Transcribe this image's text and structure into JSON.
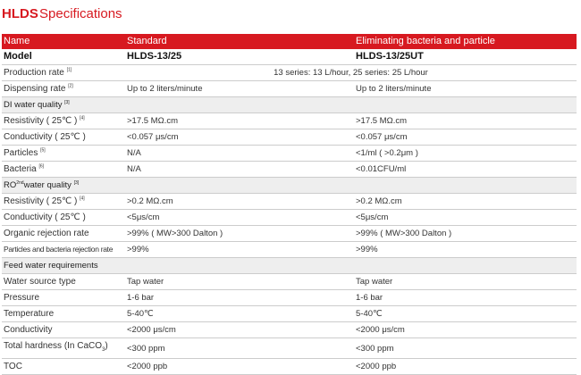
{
  "title": {
    "brand": "HLDS",
    "text": "Specifications"
  },
  "header": {
    "name": "Name",
    "standard": "Standard",
    "eliminating": "Eliminating bacteria and particle"
  },
  "model": {
    "label": "Model",
    "standard": "HLDS-13/25",
    "eliminating": "HLDS-13/25UT"
  },
  "production": {
    "label": "Production  rate",
    "note": "[1]",
    "value": "13 series: 13 L/hour, 25 series: 25 L/hour"
  },
  "dispensing": {
    "label": "Dispensing rate",
    "note": "[2]",
    "standard": "Up to 2 liters/minute",
    "eliminating": "Up to 2 liters/minute"
  },
  "di_section": {
    "label": "DI water quality",
    "note": "[3]"
  },
  "di_resistivity": {
    "label": "Resistivity ( 25℃ )",
    "note": "[4]",
    "standard": ">17.5 MΩ.cm",
    "eliminating": ">17.5 MΩ.cm"
  },
  "di_conductivity": {
    "label": "Conductivity ( 25℃ )",
    "standard": "<0.057 μs/cm",
    "eliminating": "<0.057 μs/cm"
  },
  "particles": {
    "label": "Particles",
    "note": "[5]",
    "standard": "N/A",
    "eliminating": "<1/ml ( >0.2μm )"
  },
  "bacteria": {
    "label": "Bacteria",
    "note": "[6]",
    "standard": "N/A",
    "eliminating": "<0.01CFU/ml"
  },
  "ro_section": {
    "label_pre": "RO",
    "label_sup": "2nd",
    "label_post": "water quality",
    "note": "[3]"
  },
  "ro_resistivity": {
    "label": "Resistivity ( 25℃ )",
    "note": "[4]",
    "standard": ">0.2 MΩ.cm",
    "eliminating": ">0.2 MΩ.cm"
  },
  "ro_conductivity": {
    "label": "Conductivity ( 25℃ )",
    "standard": "<5μs/cm",
    "eliminating": "<5μs/cm"
  },
  "organic": {
    "label": "Organic  rejection rate",
    "standard": ">99% ( MW>300  Dalton )",
    "eliminating": ">99% ( MW>300  Dalton )"
  },
  "particle_bacteria": {
    "label": "Particles and bacteria rejection rate",
    "standard": ">99%",
    "eliminating": ">99%"
  },
  "feed_section": {
    "label": "Feed water requirements"
  },
  "source": {
    "label": "Water source type",
    "standard": "Tap water",
    "eliminating": "Tap water"
  },
  "pressure": {
    "label": "Pressure",
    "standard": "1-6 bar",
    "eliminating": "1-6 bar"
  },
  "temperature": {
    "label": "Temperature",
    "standard": "5-40℃",
    "eliminating": "5-40℃"
  },
  "conductivity": {
    "label": "Conductivity",
    "standard": "<2000 μs/cm",
    "eliminating": "<2000 μs/cm"
  },
  "hardness": {
    "label_pre": "Total hardness (In CaCO",
    "label_sub": "3",
    "label_post": ")",
    "standard": "<300 ppm",
    "eliminating": "<300 ppm"
  },
  "toc": {
    "label": "TOC",
    "standard": "<2000 ppb",
    "eliminating": "<2000 ppb"
  }
}
